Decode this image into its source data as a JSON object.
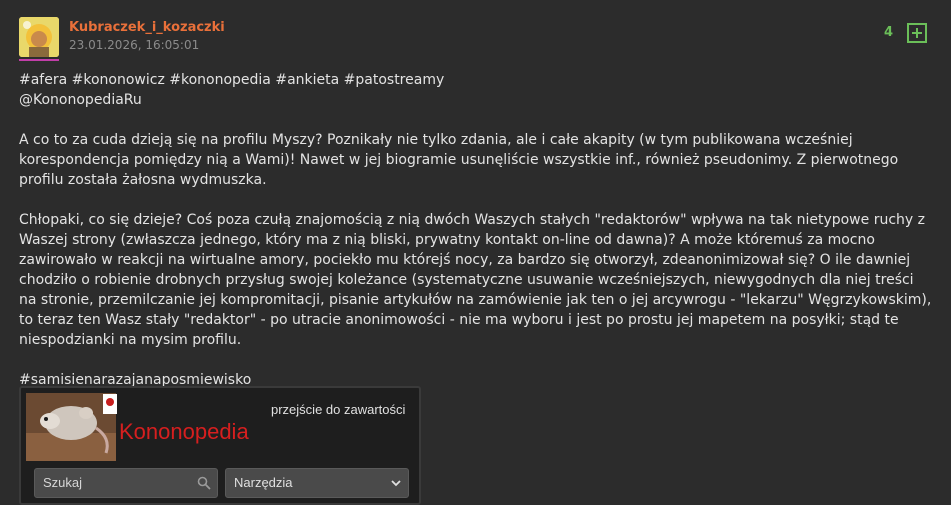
{
  "post": {
    "author": "Kubraczek_i_kozaczki",
    "timestamp": "23.01.2026, 16:05:01",
    "votes": "4",
    "tags_line": "#afera #kononowicz #kononopedia #ankieta #patostreamy",
    "mention": "@KononopediaRu",
    "paragraph1": "A co to za cuda dzieją się na profilu Myszy? Poznikały nie tylko zdania, ale i całe akapity (w tym publikowana wcześniej korespondencja pomiędzy nią a Wami)! Nawet w jej biogramie usunęliście wszystkie inf., również pseudonimy. Z pierwotnego profilu została żałosna wydmuszka.",
    "paragraph2": "Chłopaki, co się dzieje? Coś poza czułą znajomością z nią dwóch Waszych stałych \"redaktorów\" wpływa na tak nietypowe ruchy z Waszej strony (zwłaszcza jednego, który ma z nią bliski, prywatny kontakt on-line od dawna)? A może któremuś za mocno zawirowało w reakcji na wirtualne amory, pociekło mu którejś nocy, za bardzo się otworzył, zdeanonimizował się? O ile dawniej chodziło o robienie drobnych przysług swojej koleżance (systematyczne usuwanie wcześniejszych, niewygodnych dla niej treści na stronie, przemilczanie jej kompromitacji, pisanie artykułów na zamówienie jak ten o jej arcywrogu - \"lekarzu\" Węgrzykowskim), to teraz ten Wasz stały \"redaktor\" - po utracie anonimowości - nie ma wyboru i jest po prostu jej mapetem na posyłki; stąd te niespodzianki na mysim profilu.",
    "closing_tag": "#samisienarazajanaposmiewisko"
  },
  "embed": {
    "skip_link": "przejście do zawartości",
    "site_title": "Kononopedia",
    "search_placeholder": "Szukaj",
    "tools_label": "Narzędzia"
  },
  "colors": {
    "background": "#2c2c2c",
    "author": "#e9703a",
    "votes": "#6bbf59",
    "avatar_accent": "#c13ea8",
    "site_title": "#d61f1f"
  },
  "icons": {
    "vote": "plus-square-icon",
    "search": "magnifier-icon",
    "dropdown": "chevron-down-icon"
  }
}
